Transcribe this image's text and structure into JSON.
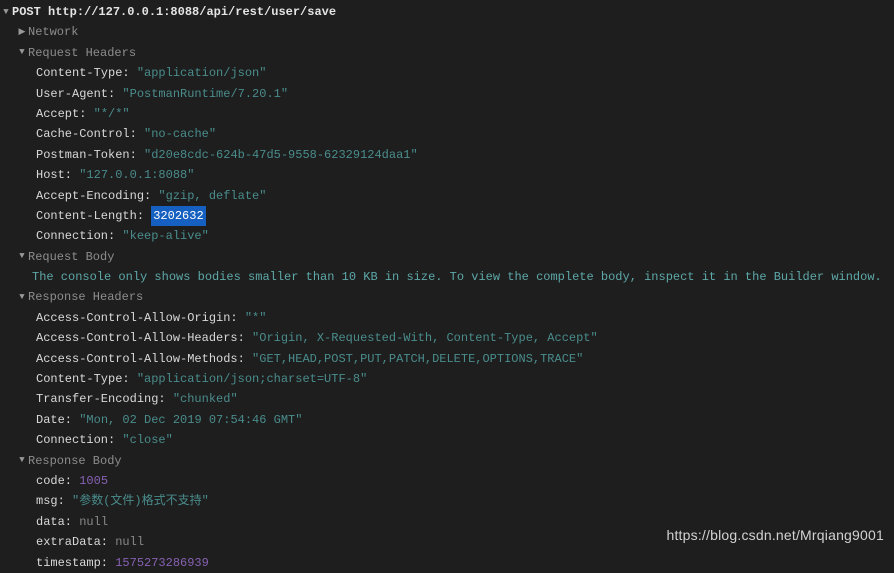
{
  "request": {
    "method": "POST",
    "url": "http://127.0.0.1:8088/api/rest/user/save"
  },
  "sections": {
    "network": "Network",
    "req_headers": "Request Headers",
    "req_body": "Request Body",
    "res_headers": "Response Headers",
    "res_body": "Response Body"
  },
  "req_headers": {
    "content_type_k": "Content-Type:",
    "content_type_v": "\"application/json\"",
    "user_agent_k": "User-Agent:",
    "user_agent_v": "\"PostmanRuntime/7.20.1\"",
    "accept_k": "Accept:",
    "accept_v": "\"*/*\"",
    "cache_control_k": "Cache-Control:",
    "cache_control_v": "\"no-cache\"",
    "postman_token_k": "Postman-Token:",
    "postman_token_v": "\"d20e8cdc-624b-47d5-9558-62329124daa1\"",
    "host_k": "Host:",
    "host_v": "\"127.0.0.1:8088\"",
    "accept_encoding_k": "Accept-Encoding:",
    "accept_encoding_v": "\"gzip, deflate\"",
    "content_length_k": "Content-Length:",
    "content_length_v": "3202632",
    "connection_k": "Connection:",
    "connection_v": "\"keep-alive\""
  },
  "req_body_msg": "The console only shows bodies smaller than 10 KB in size. To view the complete body, inspect it in the Builder window.",
  "res_headers": {
    "ac_origin_k": "Access-Control-Allow-Origin:",
    "ac_origin_v": "\"*\"",
    "ac_headers_k": "Access-Control-Allow-Headers:",
    "ac_headers_v": "\"Origin, X-Requested-With, Content-Type, Accept\"",
    "ac_methods_k": "Access-Control-Allow-Methods:",
    "ac_methods_v": "\"GET,HEAD,POST,PUT,PATCH,DELETE,OPTIONS,TRACE\"",
    "content_type_k": "Content-Type:",
    "content_type_v": "\"application/json;charset=UTF-8\"",
    "transfer_encoding_k": "Transfer-Encoding:",
    "transfer_encoding_v": "\"chunked\"",
    "date_k": "Date:",
    "date_v": "\"Mon, 02 Dec 2019 07:54:46 GMT\"",
    "connection_k": "Connection:",
    "connection_v": "\"close\""
  },
  "res_body": {
    "code_k": "code:",
    "code_v": "1005",
    "msg_k": "msg:",
    "msg_v": "\"参数(文件)格式不支持\"",
    "data_k": "data:",
    "data_v": "null",
    "extra_k": "extraData:",
    "extra_v": "null",
    "timestamp_k": "timestamp:",
    "timestamp_v": "1575273286939"
  },
  "watermark": "https://blog.csdn.net/Mrqiang9001"
}
